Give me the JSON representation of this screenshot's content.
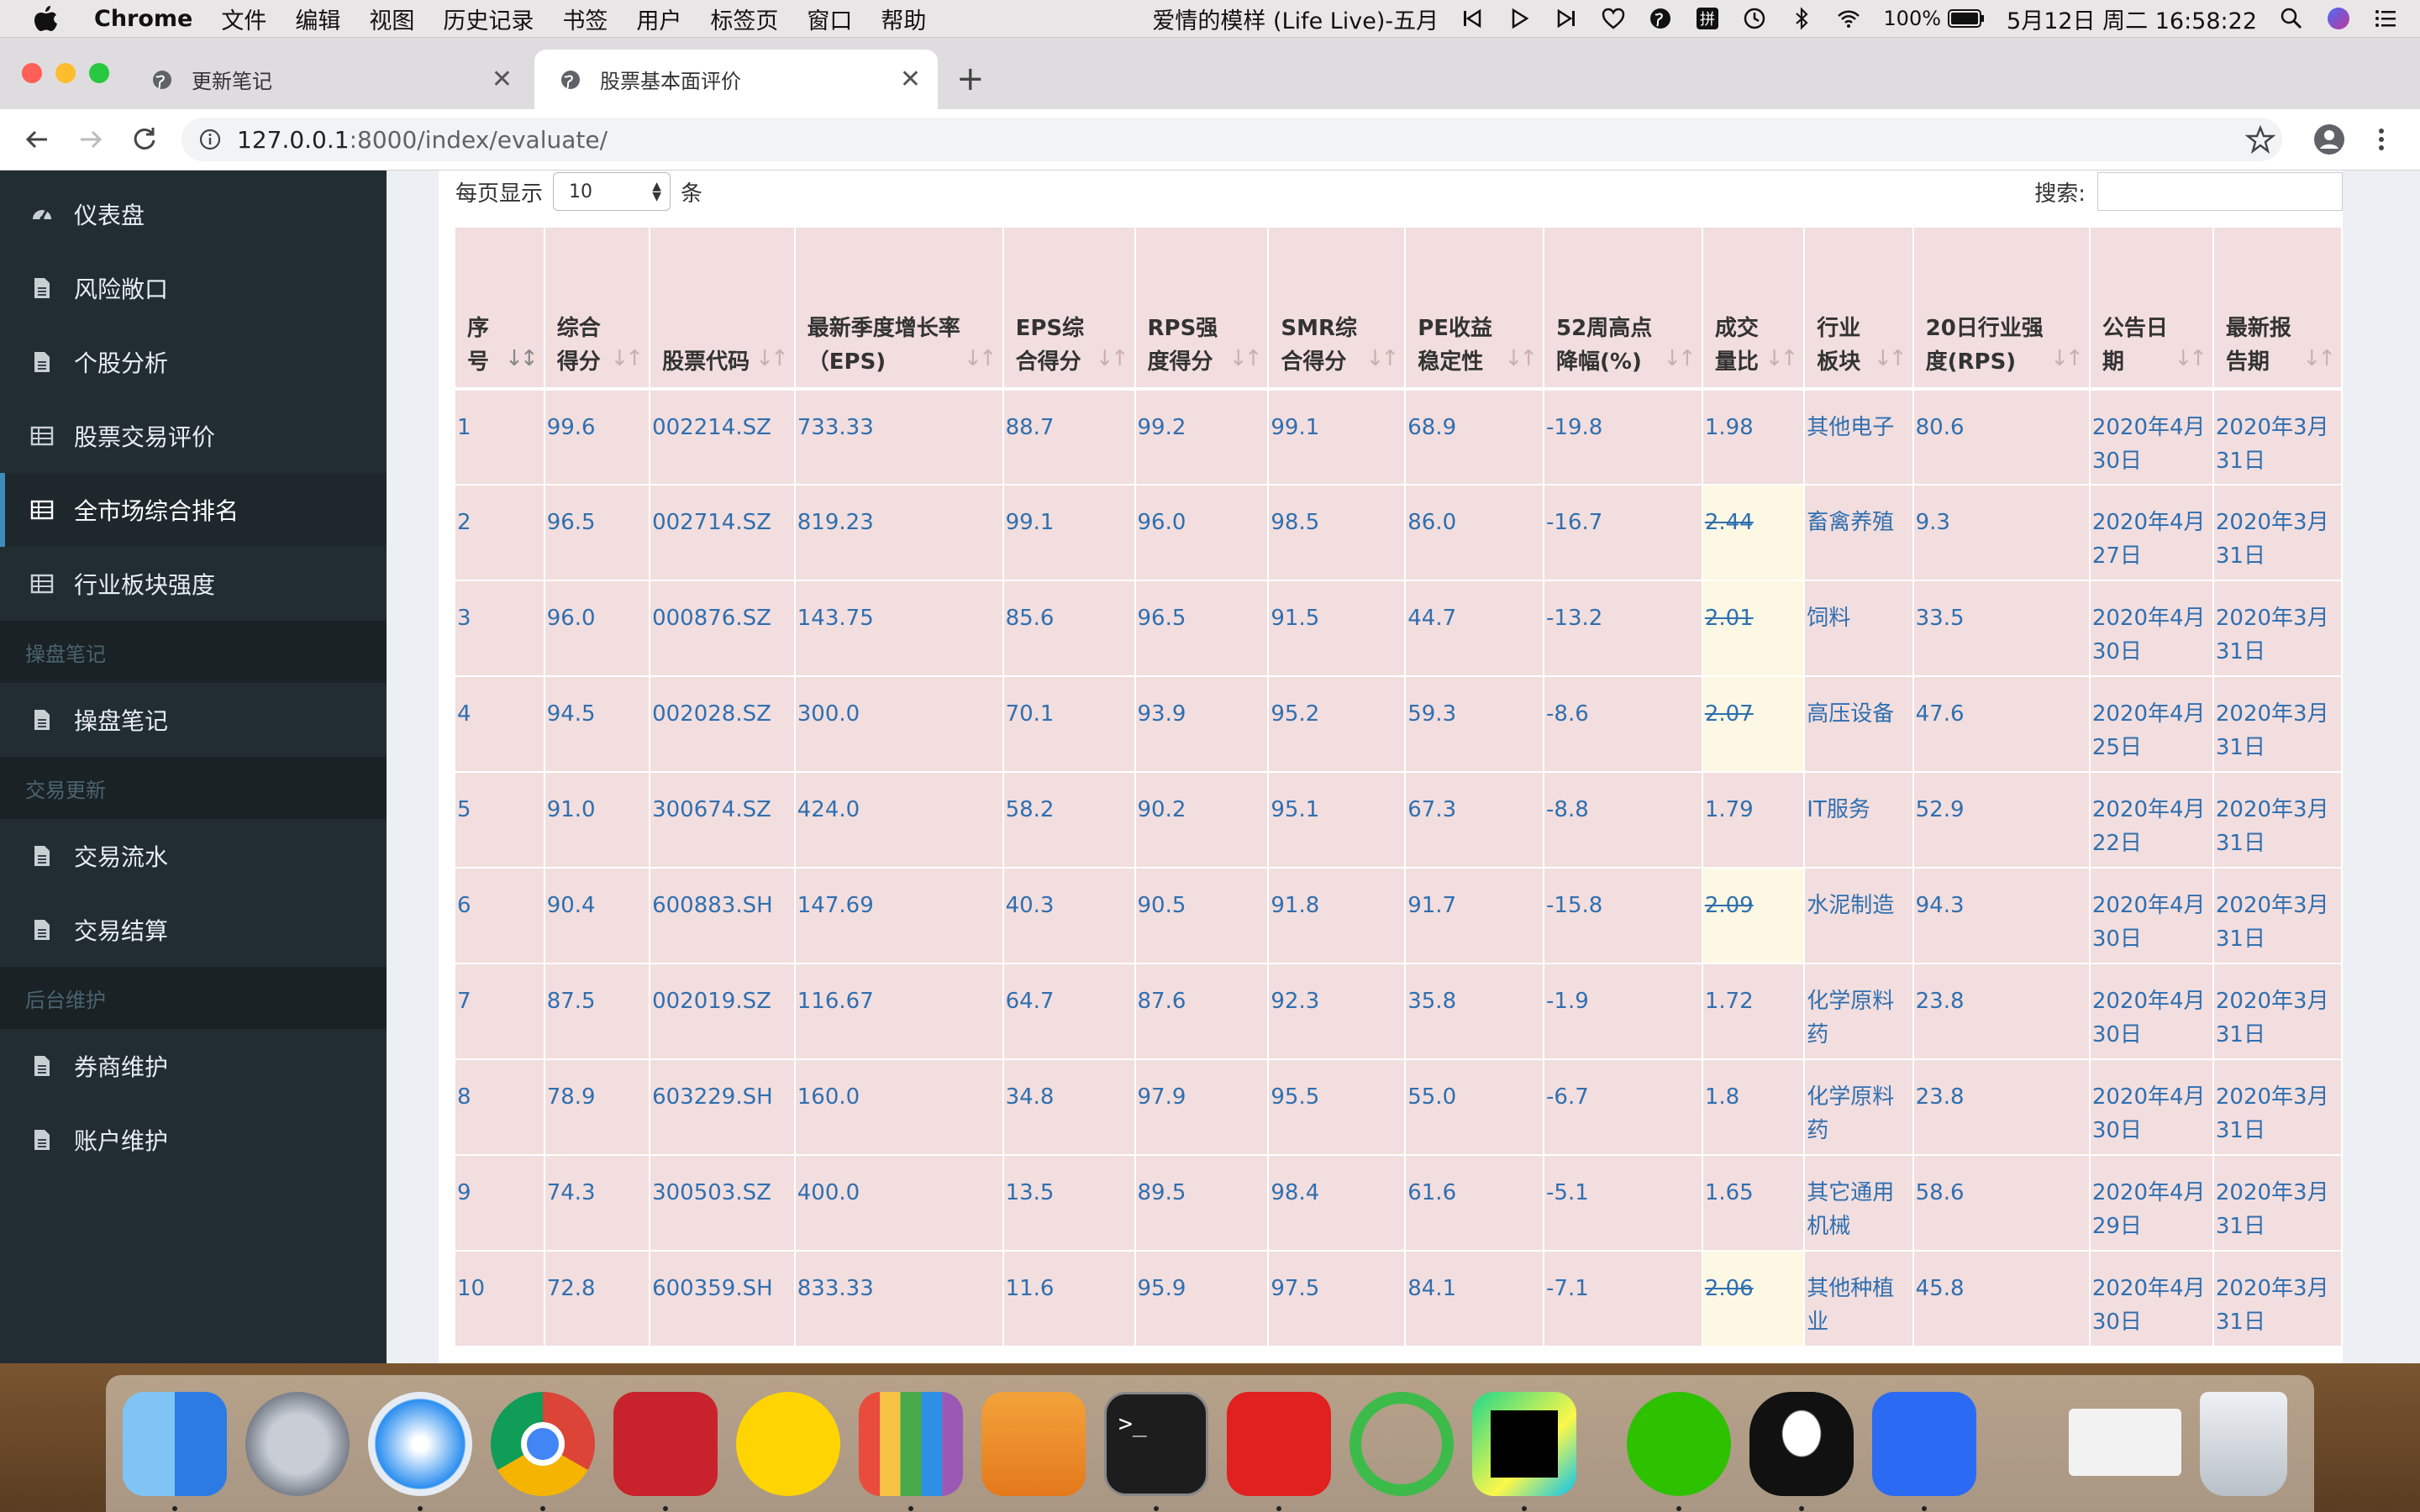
{
  "menubar": {
    "app": "Chrome",
    "menus": [
      "文件",
      "编辑",
      "视图",
      "历史记录",
      "书签",
      "用户",
      "标签页",
      "窗口",
      "帮助"
    ],
    "now_playing": "爱情的模样 (Life Live)-五月",
    "battery": "100%",
    "datetime": "5月12日 周二  16:58:22"
  },
  "tabs": [
    {
      "title": "更新笔记",
      "active": false
    },
    {
      "title": "股票基本面评价",
      "active": true
    }
  ],
  "address": {
    "host": "127.0.0.1",
    "path": ":8000/index/evaluate/"
  },
  "sidebar": {
    "items_top": [
      "仪表盘",
      "风险敞口",
      "个股分析",
      "股票交易评价",
      "全市场综合排名",
      "行业板块强度"
    ],
    "active_item": "全市场综合排名",
    "section_notes": "操盘笔记",
    "notes_item": "操盘笔记",
    "section_trade": "交易更新",
    "trade_items": [
      "交易流水",
      "交易结算"
    ],
    "section_admin": "后台维护",
    "admin_items": [
      "券商维护",
      "账户维护"
    ]
  },
  "table_controls": {
    "length_label_pre": "每页显示",
    "length_value": "10",
    "length_label_post": "条",
    "search_label": "搜索:"
  },
  "table": {
    "columns": [
      "序号",
      "综合得分",
      "股票代码",
      "最新季度增长率（EPS)",
      "EPS综合得分",
      "RPS强度得分",
      "SMR综合得分",
      "PE收益稳定性",
      "52周高点降幅(%)",
      "成交量比",
      "行业板块",
      "20日行业强度(RPS)",
      "公告日期",
      "最新报告期"
    ],
    "rows": [
      [
        "1",
        "99.6",
        "002214.SZ",
        "733.33",
        "88.7",
        "99.2",
        "99.1",
        "68.9",
        "-19.8",
        "1.98",
        "其他电子",
        "80.6",
        "2020年4月30日",
        "2020年3月31日"
      ],
      [
        "2",
        "96.5",
        "002714.SZ",
        "819.23",
        "99.1",
        "96.0",
        "98.5",
        "86.0",
        "-16.7",
        "2.44",
        "畜禽养殖",
        "9.3",
        "2020年4月27日",
        "2020年3月31日"
      ],
      [
        "3",
        "96.0",
        "000876.SZ",
        "143.75",
        "85.6",
        "96.5",
        "91.5",
        "44.7",
        "-13.2",
        "2.01",
        "饲料",
        "33.5",
        "2020年4月30日",
        "2020年3月31日"
      ],
      [
        "4",
        "94.5",
        "002028.SZ",
        "300.0",
        "70.1",
        "93.9",
        "95.2",
        "59.3",
        "-8.6",
        "2.07",
        "高压设备",
        "47.6",
        "2020年4月25日",
        "2020年3月31日"
      ],
      [
        "5",
        "91.0",
        "300674.SZ",
        "424.0",
        "58.2",
        "90.2",
        "95.1",
        "67.3",
        "-8.8",
        "1.79",
        "IT服务",
        "52.9",
        "2020年4月22日",
        "2020年3月31日"
      ],
      [
        "6",
        "90.4",
        "600883.SH",
        "147.69",
        "40.3",
        "90.5",
        "91.8",
        "91.7",
        "-15.8",
        "2.09",
        "水泥制造",
        "94.3",
        "2020年4月30日",
        "2020年3月31日"
      ],
      [
        "7",
        "87.5",
        "002019.SZ",
        "116.67",
        "64.7",
        "87.6",
        "92.3",
        "35.8",
        "-1.9",
        "1.72",
        "化学原料药",
        "23.8",
        "2020年4月30日",
        "2020年3月31日"
      ],
      [
        "8",
        "78.9",
        "603229.SH",
        "160.0",
        "34.8",
        "97.9",
        "95.5",
        "55.0",
        "-6.7",
        "1.8",
        "化学原料药",
        "23.8",
        "2020年4月30日",
        "2020年3月31日"
      ],
      [
        "9",
        "74.3",
        "300503.SZ",
        "400.0",
        "13.5",
        "89.5",
        "98.4",
        "61.6",
        "-5.1",
        "1.65",
        "其它通用机械",
        "58.6",
        "2020年4月29日",
        "2020年3月31日"
      ],
      [
        "10",
        "72.8",
        "600359.SH",
        "833.33",
        "11.6",
        "95.9",
        "97.5",
        "84.1",
        "-7.1",
        "2.06",
        "其他种植业",
        "45.8",
        "2020年4月30日",
        "2020年3月31日"
      ]
    ],
    "highlight_rows": [
      2,
      3,
      4,
      6,
      10
    ]
  },
  "colors": {
    "sidebar_bg": "#222d32",
    "accent": "#3c8dbc",
    "row_bg": "#f2dede",
    "highlight_bg": "#fcf8e3",
    "link": "#2f6fb0"
  },
  "dock": [
    "finder-icon",
    "launchpad-icon",
    "safari-icon",
    "chrome-icon",
    "poker-icon",
    "qqmusic-icon",
    "numbers-icon",
    "pages-icon",
    "terminal-icon",
    "youdao-icon",
    "circle-app-icon",
    "pycharm-icon",
    "wechat-icon",
    "qq-icon",
    "lark-icon",
    "chrome-window-thumbnail",
    "trash-icon"
  ]
}
